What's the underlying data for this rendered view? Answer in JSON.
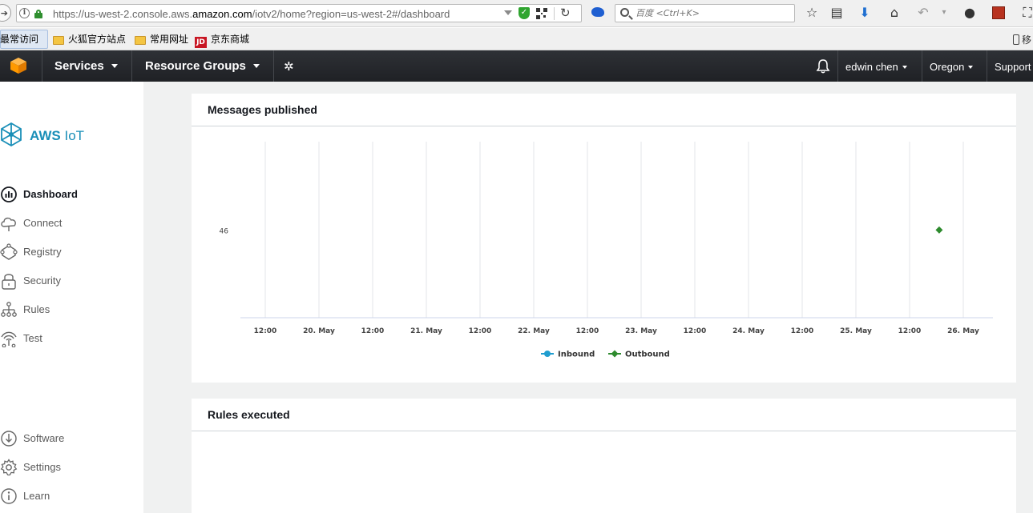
{
  "browser": {
    "url_prefix": "https://us-west-2.console.aws.",
    "url_domain": "amazon.com",
    "url_suffix": "/iotv2/home?region=us-west-2#/dashboard",
    "search_placeholder": "百度 <Ctrl+K>"
  },
  "bookmarks": {
    "items": [
      {
        "label": "最常访问",
        "icon": "page-icon"
      },
      {
        "label": "火狐官方站点",
        "icon": "folder-icon"
      },
      {
        "label": "常用网址",
        "icon": "folder-icon"
      },
      {
        "label": "京东商城",
        "icon": "jd-icon",
        "icon_text": "JD"
      }
    ],
    "mobile_label": "移"
  },
  "header": {
    "services_label": "Services",
    "resource_groups_label": "Resource Groups",
    "user_label": "edwin chen",
    "region_label": "Oregon",
    "support_label": "Support"
  },
  "sidebar": {
    "brand_bold": "AWS",
    "brand_light": "IoT",
    "items": [
      {
        "label": "Dashboard",
        "icon": "dashboard-icon",
        "active": true
      },
      {
        "label": "Connect",
        "icon": "cloud-icon"
      },
      {
        "label": "Registry",
        "icon": "registry-icon"
      },
      {
        "label": "Security",
        "icon": "lock-icon"
      },
      {
        "label": "Rules",
        "icon": "rules-icon"
      },
      {
        "label": "Test",
        "icon": "test-icon"
      }
    ],
    "bottom_items": [
      {
        "label": "Software",
        "icon": "download-icon"
      },
      {
        "label": "Settings",
        "icon": "gear-icon"
      },
      {
        "label": "Learn",
        "icon": "info-icon"
      }
    ]
  },
  "cards": {
    "messages_title": "Messages published",
    "rules_title": "Rules executed"
  },
  "colors": {
    "inbound": "#1f9dcf",
    "outbound": "#2e8b2e",
    "aws_orange": "#ff9900",
    "brand_blue": "#1a8fb8"
  },
  "chart_data": {
    "type": "line",
    "title": "Messages published",
    "x_tick_labels": [
      "12:00",
      "20. May",
      "12:00",
      "21. May",
      "12:00",
      "22. May",
      "12:00",
      "23. May",
      "12:00",
      "24. May",
      "12:00",
      "25. May",
      "12:00",
      "26. May"
    ],
    "xlim": [
      "2017-05-19 06:00",
      "2017-05-26 06:00"
    ],
    "y_tick_labels": [
      "46"
    ],
    "series": [
      {
        "name": "Inbound",
        "points": []
      },
      {
        "name": "Outbound",
        "points": [
          {
            "x": "2017-05-25 18:00",
            "y": 46
          }
        ]
      }
    ],
    "grid": true,
    "legend_position": "bottom"
  }
}
